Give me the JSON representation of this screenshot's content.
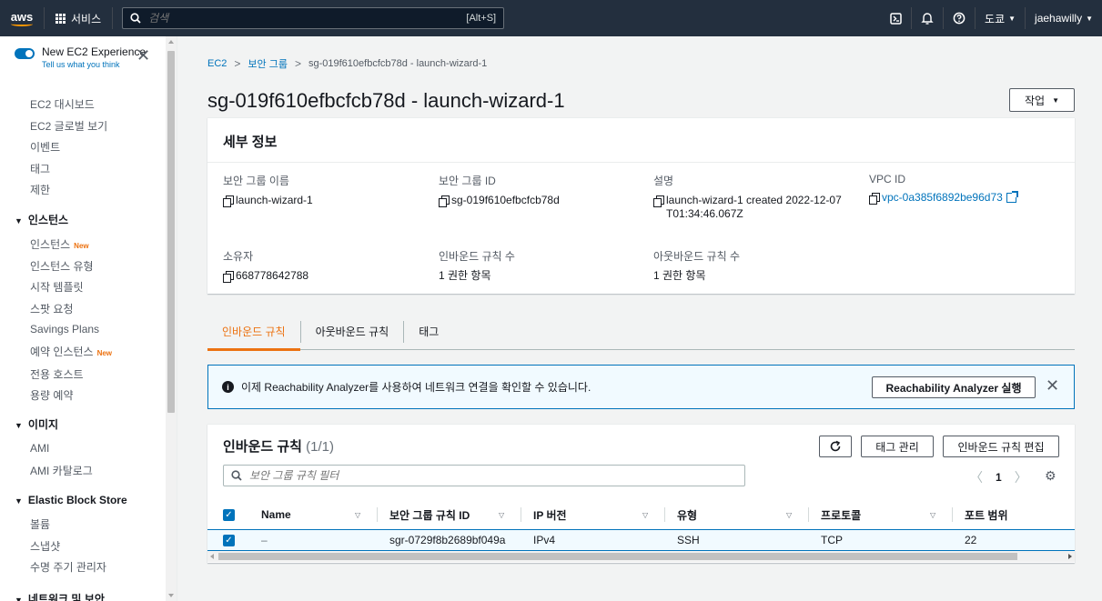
{
  "topnav": {
    "logo": "aws",
    "services_label": "서비스",
    "search_placeholder": "검색",
    "search_shortcut": "[Alt+S]",
    "tools": [
      "cloudshell-icon",
      "bell-icon",
      "help-icon"
    ],
    "region": "도쿄",
    "user": "jaehawilly"
  },
  "sidebar": {
    "experience_title": "New EC2 Experience",
    "experience_sub": "Tell us what you think",
    "items_top": [
      "EC2 대시보드",
      "EC2 글로벌 보기",
      "이벤트",
      "태그",
      "제한"
    ],
    "sec_instances": "인스턴스",
    "instances": [
      "인스턴스",
      "인스턴스 유형",
      "시작 템플릿",
      "스팟 요청",
      "Savings Plans",
      "예약 인스턴스",
      "전용 호스트",
      "용량 예약"
    ],
    "new_badge": "New",
    "sec_images": "이미지",
    "images": [
      "AMI",
      "AMI 카탈로그"
    ],
    "sec_ebs": "Elastic Block Store",
    "ebs": [
      "볼륨",
      "스냅샷",
      "수명 주기 관리자"
    ],
    "sec_network": "네트워크 및 보안"
  },
  "breadcrumb": [
    "EC2",
    "보안 그룹",
    "sg-019f610efbcfcb78d - launch-wizard-1"
  ],
  "page_title": "sg-019f610efbcfcb78d - launch-wizard-1",
  "actions_label": "작업",
  "details": {
    "title": "세부 정보",
    "sg_name_label": "보안 그룹 이름",
    "sg_name": "launch-wizard-1",
    "sg_id_label": "보안 그룹 ID",
    "sg_id": "sg-019f610efbcfcb78d",
    "desc_label": "설명",
    "desc": "launch-wizard-1 created 2022-12-07T01:34:46.067Z",
    "vpc_label": "VPC ID",
    "vpc": "vpc-0a385f6892be96d73",
    "owner_label": "소유자",
    "owner": "668778642788",
    "inbound_count_label": "인바운드 규칙 수",
    "inbound_count": "1 권한 항목",
    "outbound_count_label": "아웃바운드 규칙 수",
    "outbound_count": "1 권한 항목"
  },
  "tabs": [
    "인바운드 규칙",
    "아웃바운드 규칙",
    "태그"
  ],
  "info_banner": {
    "text": "이제 Reachability Analyzer를 사용하여 네트워크 연결을 확인할 수 있습니다.",
    "button": "Reachability Analyzer 실행"
  },
  "rules": {
    "title": "인바운드 규칙",
    "count": "(1/1)",
    "tag_button": "태그 관리",
    "edit_button": "인바운드 규칙 편집",
    "filter_placeholder": "보안 그룹 규칙 필터",
    "page": "1",
    "columns": [
      "Name",
      "보안 그룹 규칙 ID",
      "IP 버전",
      "유형",
      "프로토콜",
      "포트 범위"
    ],
    "row": [
      "–",
      "sgr-0729f8b2689bf049a",
      "IPv4",
      "SSH",
      "TCP",
      "22"
    ]
  },
  "colors": {
    "accent": "#ec7211",
    "link": "#0073bb",
    "nav_bg": "#232f3e"
  }
}
